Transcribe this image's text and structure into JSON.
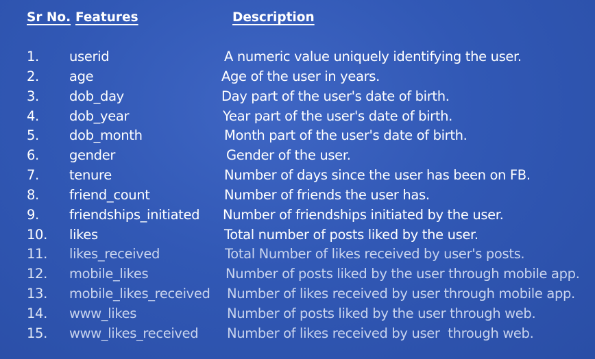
{
  "headers": {
    "sr_no": "Sr No.",
    "features": "Features",
    "description": "Description"
  },
  "rows": [
    {
      "num": "1.",
      "feature": "userid",
      "description": "A numeric value uniquely identifying the user."
    },
    {
      "num": "2.",
      "feature": "age",
      "description": "Age of the user in years."
    },
    {
      "num": "3.",
      "feature": "dob_day",
      "description": "Day part of the user's date of birth."
    },
    {
      "num": "4.",
      "feature": "dob_year",
      "description": "Year part of the user's date of birth."
    },
    {
      "num": "5.",
      "feature": "dob_month",
      "description": "Month part of the user's date of birth."
    },
    {
      "num": "6.",
      "feature": "gender",
      "description": "Gender of the user."
    },
    {
      "num": "7.",
      "feature": "tenure",
      "description": "Number of days since the user has been on FB."
    },
    {
      "num": "8.",
      "feature": "friend_count",
      "description": "Number of friends the user has."
    },
    {
      "num": "9.",
      "feature": "friendships_initiated",
      "description": "Number of friendships initiated by the user."
    },
    {
      "num": "10.",
      "feature": "likes",
      "description": "Total number of posts liked by the user."
    },
    {
      "num": "11.",
      "feature": "likes_received",
      "description": "Total Number of likes received by user's posts."
    },
    {
      "num": "12.",
      "feature": "mobile_likes",
      "description": "Number of posts liked by the user through mobile app."
    },
    {
      "num": "13.",
      "feature": "mobile_likes_received",
      "description": "Number of likes received by user through mobile app."
    },
    {
      "num": "14.",
      "feature": "www_likes",
      "description": "Number of posts liked by the user through web."
    },
    {
      "num": "15.",
      "feature": "www_likes_received",
      "description": "Number of likes received by user  through web."
    }
  ],
  "colors": {
    "background": "#3158b5",
    "text": "#ffffff",
    "text_light": "#c9d4ee"
  }
}
